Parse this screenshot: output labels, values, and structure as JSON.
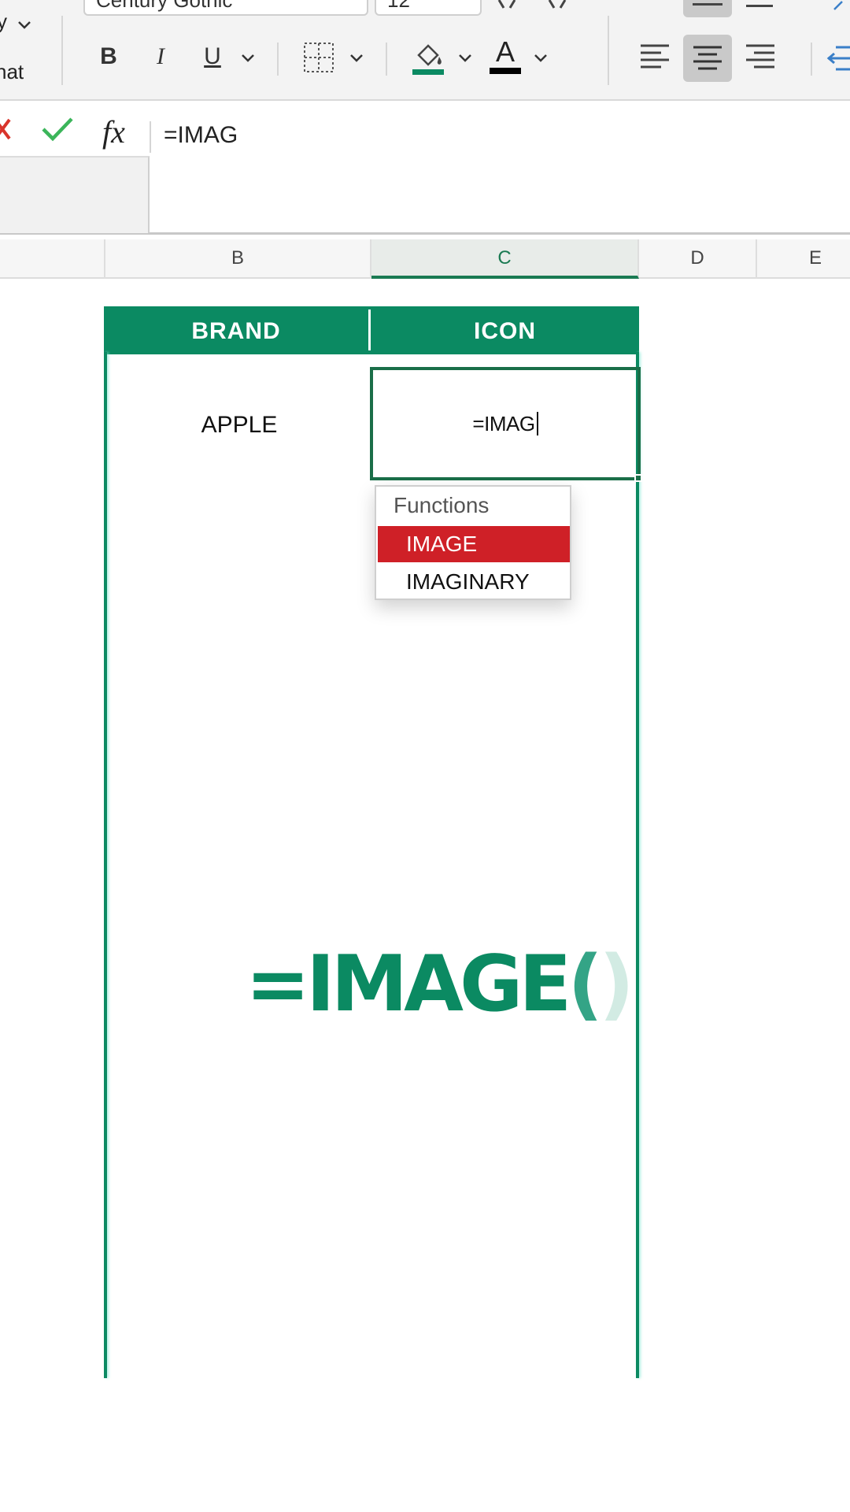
{
  "ribbon": {
    "partial_label_top": "y",
    "partial_label_format": "nat",
    "font_name": "Century Gothic",
    "font_size": "12",
    "bold_label": "B",
    "italic_label": "I",
    "underline_label": "U",
    "font_color_label": "A",
    "font_color_bar": "#000000",
    "fill_color_bar": "#0b8a62"
  },
  "formula_bar": {
    "formula": "=IMAG",
    "fx_label": "fx"
  },
  "columns": [
    "B",
    "C",
    "D",
    "E"
  ],
  "table": {
    "headers": [
      "BRAND",
      "ICON"
    ],
    "brand": "APPLE",
    "icon_cell_text": "=IMAG"
  },
  "autocomplete": {
    "title": "Functions",
    "items": [
      "IMAGE",
      "IMAGINARY"
    ],
    "selected": "IMAGE"
  },
  "caption": {
    "text": "=IMAGE",
    "paren_open": "(",
    "paren_close": ")"
  },
  "colors": {
    "accent_green": "#0b8a62",
    "selection_red": "#cf2027",
    "cancel_red": "#d9342b",
    "confirm_green": "#3bb55a"
  }
}
